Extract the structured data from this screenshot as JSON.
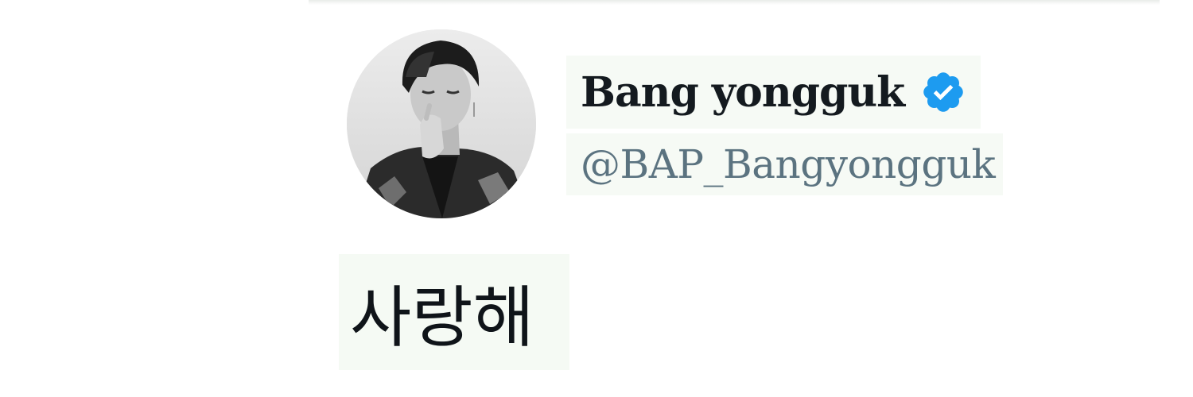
{
  "tweet": {
    "author": {
      "display_name": "Bang yongguk",
      "handle": "@BAP_Bangyongguk",
      "verified": true,
      "verified_badge_color": "#1d9bf0",
      "avatar_icon": "profile-photo"
    },
    "text": "사랑해"
  },
  "colors": {
    "name": "#141a1f",
    "handle": "#5b7380",
    "text": "#0f1419",
    "background": "#ffffff"
  }
}
